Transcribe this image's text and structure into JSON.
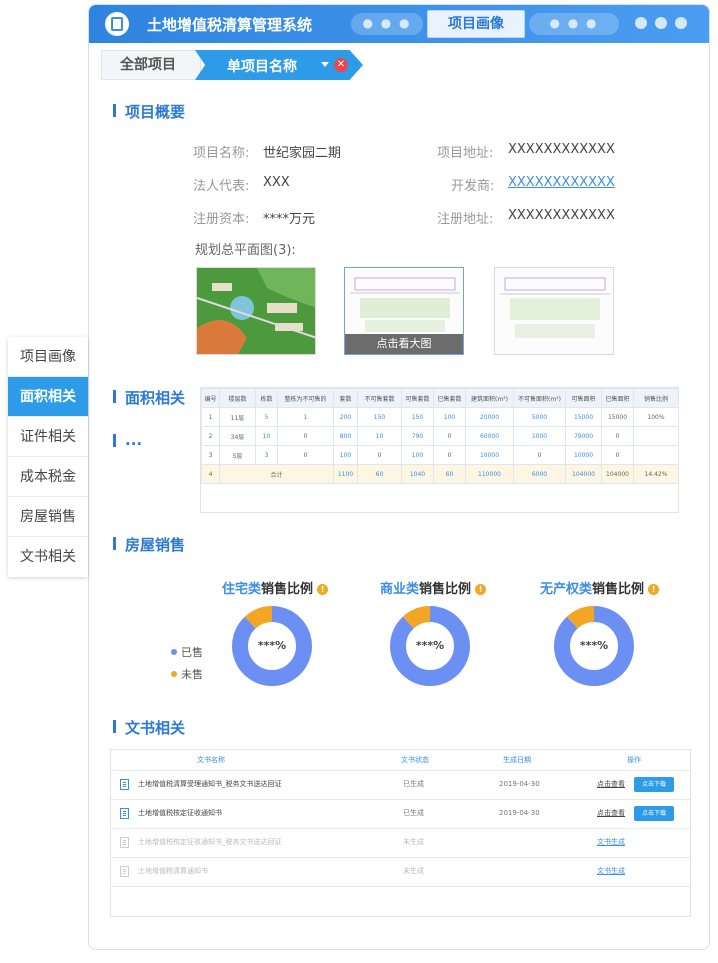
{
  "header": {
    "app_title": "土地增值税清算管理系统",
    "tab_dots_left": "● ● ●",
    "active_tab": "项目画像",
    "tab_dots_right": "● ● ●"
  },
  "breadcrumb": {
    "all_projects": "全部项目",
    "single_project": "单项目名称"
  },
  "overview": {
    "section_title": "项目概要",
    "fields": {
      "name_label": "项目名称:",
      "name_value": "世纪家园二期",
      "address_label": "项目地址:",
      "address_value": "XXXXXXXXXXXX",
      "rep_label": "法人代表:",
      "rep_value": "XXX",
      "developer_label": "开发商:",
      "developer_value": "XXXXXXXXXXXX",
      "capital_label": "注册资本:",
      "capital_value": "****万元",
      "reg_address_label": "注册地址:",
      "reg_address_value": "XXXXXXXXXXXX"
    },
    "plan_label": "规划总平面图(3):",
    "view_large": "点击看大图"
  },
  "sidebar": {
    "items": [
      {
        "label": "项目画像"
      },
      {
        "label": "面积相关"
      },
      {
        "label": "证件相关"
      },
      {
        "label": "成本税金"
      },
      {
        "label": "房屋销售"
      },
      {
        "label": "文书相关"
      }
    ],
    "active_index": 1
  },
  "area": {
    "section_title": "面积相关",
    "more_title": "...",
    "headers": [
      "编号",
      "楼层数",
      "栋数",
      "整栋为不可售的",
      "套数",
      "不可售套数",
      "可售套数",
      "已售套数",
      "建筑面积(m²)",
      "不可售面积(m²)",
      "可售面积",
      "已售面积",
      "销售比例"
    ],
    "rows": [
      [
        "1",
        "11层",
        "5",
        "1",
        "200",
        "150",
        "150",
        "100",
        "20000",
        "5000",
        "15000",
        "15000",
        "100%"
      ],
      [
        "2",
        "34层",
        "10",
        "0",
        "800",
        "10",
        "790",
        "0",
        "60000",
        "1000",
        "79000",
        "0",
        ""
      ],
      [
        "3",
        "5层",
        "3",
        "0",
        "100",
        "0",
        "100",
        "0",
        "10000",
        "0",
        "10000",
        "0",
        ""
      ]
    ],
    "total_row": [
      "4",
      "合计",
      "1100",
      "60",
      "1040",
      "60",
      "110000",
      "6000",
      "104000",
      "104000",
      "14.42%"
    ]
  },
  "sales": {
    "section_title": "房屋销售",
    "legend_sold": "已售",
    "legend_unsold": "未售",
    "warn_icon": "!",
    "charts": [
      {
        "highlight": "住宅类",
        "rest": "销售比例",
        "center": "***%"
      },
      {
        "highlight": "商业类",
        "rest": "销售比例",
        "center": "***%"
      },
      {
        "highlight": "无产权类",
        "rest": "销售比例",
        "center": "***%"
      }
    ]
  },
  "chart_data": [
    {
      "type": "pie",
      "title": "住宅类销售比例",
      "categories": [
        "已售",
        "未售"
      ],
      "values": [
        88,
        12
      ],
      "colors": [
        "#6b8ff2",
        "#f2a623"
      ]
    },
    {
      "type": "pie",
      "title": "商业类销售比例",
      "categories": [
        "已售",
        "未售"
      ],
      "values": [
        88,
        12
      ],
      "colors": [
        "#6b8ff2",
        "#f2a623"
      ]
    },
    {
      "type": "pie",
      "title": "无产权类销售比例",
      "categories": [
        "已售",
        "未售"
      ],
      "values": [
        88,
        12
      ],
      "colors": [
        "#6b8ff2",
        "#f2a623"
      ]
    }
  ],
  "documents": {
    "section_title": "文书相关",
    "headers": {
      "name": "文书名称",
      "status": "文书状态",
      "date": "生成日期",
      "action": "操作"
    },
    "rows": [
      {
        "name": "土地增值税清算受理通知书_税务文书送达回证",
        "status": "已生成",
        "date": "2019-04-30",
        "view": "点击查看",
        "download": "点击下载",
        "generated": true
      },
      {
        "name": "土地增值税核定征收通知书",
        "status": "已生成",
        "date": "2019-04-30",
        "view": "点击查看",
        "download": "点击下载",
        "generated": true
      },
      {
        "name": "土地增值税核定征收通知书_税务文书送达回证",
        "status": "未生成",
        "date": "",
        "view": "文书生成",
        "download": "",
        "generated": false
      },
      {
        "name": "土地增值税清算通知书",
        "status": "未生成",
        "date": "",
        "view": "文书生成",
        "download": "",
        "generated": false
      }
    ]
  },
  "colors": {
    "primary": "#2d9be8",
    "sold": "#6b8ff2",
    "unsold": "#f2a623",
    "danger": "#e8474e"
  }
}
